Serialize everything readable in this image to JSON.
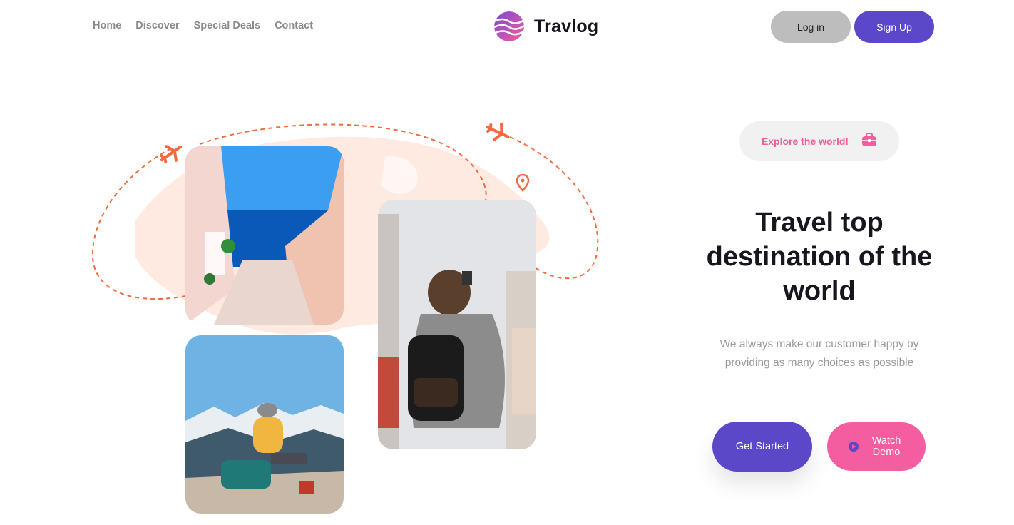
{
  "header": {
    "nav": [
      "Home",
      "Discover",
      "Special Deals",
      "Contact"
    ],
    "brand": "Travlog",
    "login_label": "Log in",
    "signup_label": "Sign Up"
  },
  "hero": {
    "badge": "Explore the world!",
    "headline": "Travel top destination of the world",
    "subtext": "We always make our customer happy by providing as many choices as possible",
    "get_started_label": "Get Started",
    "watch_demo_label": "Watch Demo",
    "photos": [
      "santorini-stairs-photo",
      "hiker-on-mountain-photo",
      "backpacker-in-city-photo"
    ]
  },
  "colors": {
    "primary": "#5b48c8",
    "pink": "#f45d9f",
    "accent_orange": "#f26a3d",
    "map_tint": "#ffe6dc"
  }
}
